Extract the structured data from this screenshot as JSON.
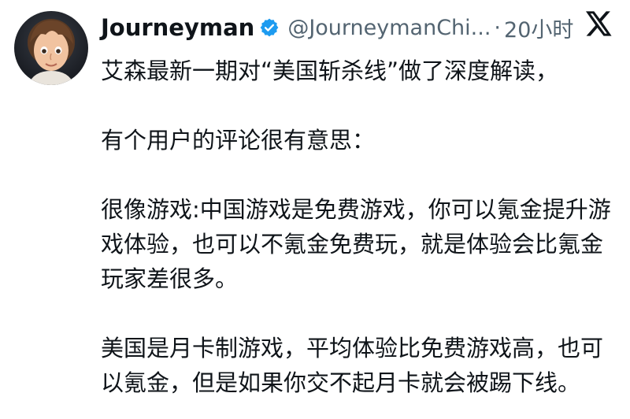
{
  "tweet": {
    "author_name": "Journeyman",
    "author_handle": "@JourneymanChi...",
    "separator": "·",
    "timestamp": "20小时",
    "verified_color": "#1d9bf0",
    "icons": {
      "verified": "verified-badge-icon",
      "platform": "x-logo-icon"
    },
    "paragraphs": [
      "艾森最新一期对“美国斩杀线”做了深度解读，",
      "有个用户的评论很有意思：",
      "很像游戏:中国游戏是免费游戏，你可以氪金提升游戏体验，也可以不氪金免费玩，就是体验会比氪金玩家差很多。",
      "美国是月卡制游戏，平均体验比免费游戏高，也可以氪金，但是如果你交不起月卡就会被踢下线。"
    ]
  }
}
